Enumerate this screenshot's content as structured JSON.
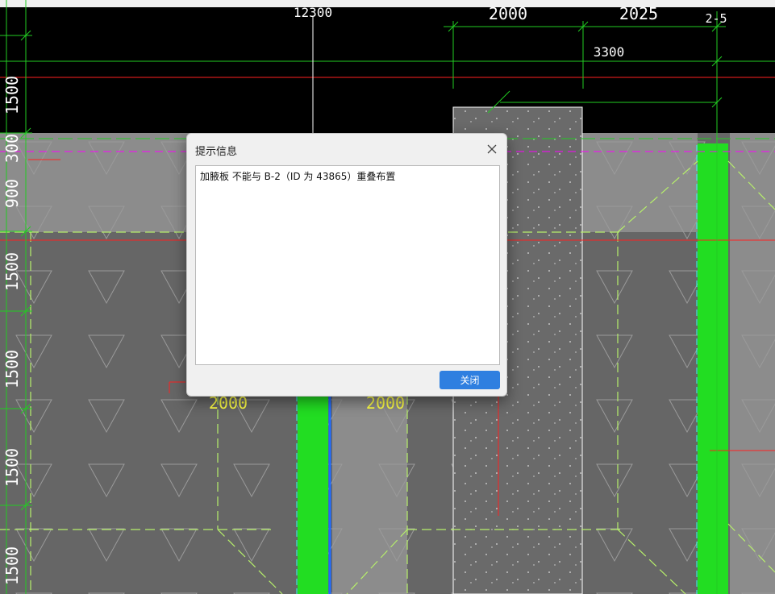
{
  "drawing": {
    "dimensions": {
      "top_12300": "12300",
      "top_2000": "2000",
      "top_2025": "2025",
      "top_25": "2-5",
      "top_3300": "3300",
      "left_1500_a": "1500",
      "left_300": "300",
      "left_900": "900",
      "left_1500_b": "1500",
      "left_1500_c": "1500",
      "left_1500_d": "1500",
      "left_1500_e": "1500",
      "mid_2000_a": "2000",
      "mid_2000_b": "2000"
    },
    "colors": {
      "background": "#000000",
      "slab_dark": "#666666",
      "slab_light": "#8c8c8c",
      "green_wall": "#22dd22",
      "dim_green": "#22cc22",
      "dash_green": "#b7f06b",
      "magenta": "#ff00ff",
      "red": "#ff2020",
      "yellow_text": "#ffff44"
    }
  },
  "dialog": {
    "title": "提示信息",
    "message": "加腋板 不能与 B-2（ID 为 43865）重叠布置",
    "close_button": "关闭",
    "accent": "#2f7fe0"
  }
}
